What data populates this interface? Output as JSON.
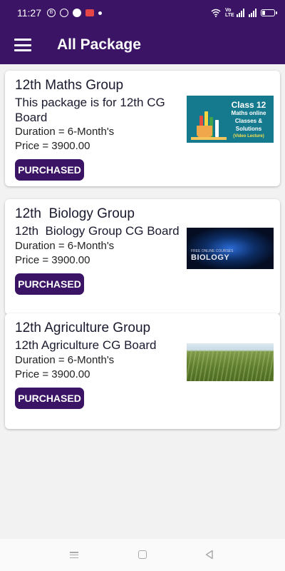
{
  "status_bar": {
    "time": "11:27",
    "notification_icons": [
      "b-circle-icon",
      "whatsapp-icon",
      "message-icon",
      "app-badge-icon",
      "dot-icon"
    ],
    "network_label": "Vo LTE",
    "right_icons": [
      "wifi-icon",
      "signal-icon",
      "signal-icon",
      "battery-icon"
    ]
  },
  "app_bar": {
    "menu_icon": "hamburger-menu-icon",
    "title": "All Package"
  },
  "packages": [
    {
      "name": "12th Maths Group",
      "description": "This package is for 12th CG Board",
      "duration": "Duration = 6-Month's",
      "price": "Price = 3900.00",
      "button": "PURCHASED",
      "thumbnail": {
        "line1": "Class 12",
        "line2": "Maths online",
        "line3": "Classes &",
        "line4": "Solutions",
        "line5": "(Video Lecture)"
      }
    },
    {
      "name": "12th  Biology Group",
      "description": "12th  Biology Group CG Board",
      "duration": "Duration = 6-Month's",
      "price": "Price = 3900.00",
      "button": "PURCHASED",
      "thumbnail": {
        "small": "FREE ONLINE COURSES",
        "label": "BIOLOGY"
      }
    },
    {
      "name": "12th Agriculture Group",
      "description": "12th Agriculture CG Board",
      "duration": "Duration = 6-Month's",
      "price": "Price = 3900.00",
      "button": "PURCHASED",
      "thumbnail": {}
    }
  ],
  "nav_bar": {
    "icons": [
      "recent-apps-icon",
      "home-icon",
      "back-icon"
    ]
  },
  "colors": {
    "primary": "#3b1466",
    "background": "#f2f2f2",
    "card": "#ffffff"
  }
}
